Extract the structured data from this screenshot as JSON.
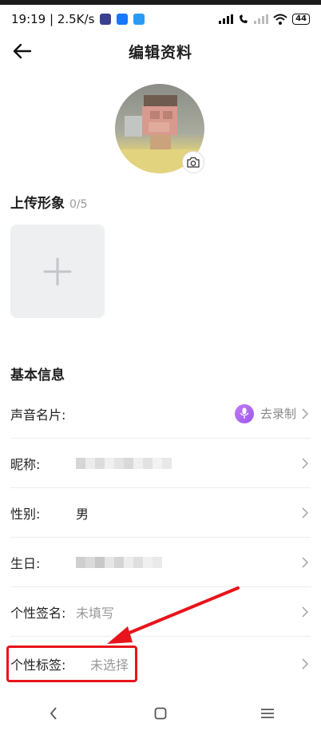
{
  "status_bar": {
    "time_speed": "19:19 | 2.5K/s",
    "battery": "44"
  },
  "header": {
    "title": "编辑资料"
  },
  "upload": {
    "title": "上传形象",
    "count": "0/5"
  },
  "basic": {
    "title": "基本信息",
    "rows": [
      {
        "label": "声音名片:",
        "action": "去录制"
      },
      {
        "label": "昵称:",
        "value": ""
      },
      {
        "label": "性别:",
        "value": "男"
      },
      {
        "label": "生日:",
        "value": ""
      },
      {
        "label": "个性签名:",
        "value": "未填写"
      },
      {
        "label": "个性标签:",
        "value": "未选择"
      }
    ]
  },
  "colors": {
    "accent_purple": "#a15ef0",
    "highlight_red": "#e8141b"
  }
}
